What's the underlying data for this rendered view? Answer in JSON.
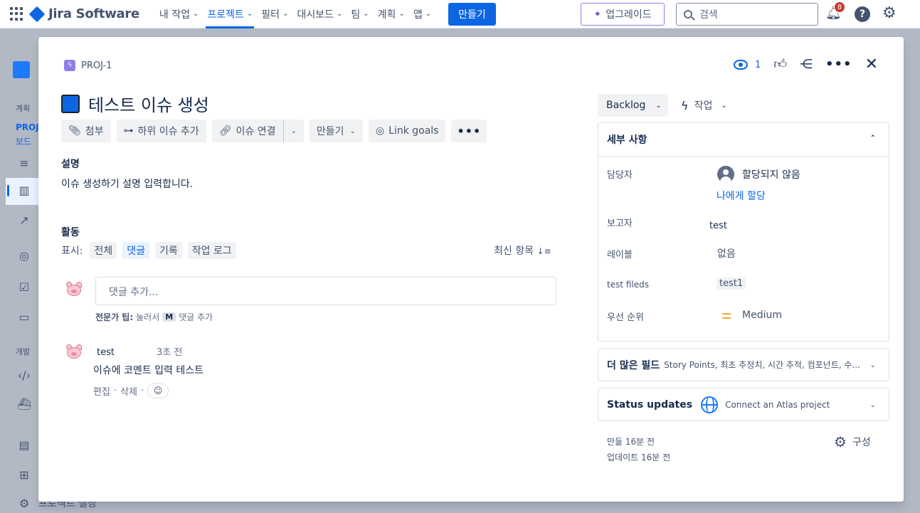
{
  "topnav": {
    "product": "Jira Software",
    "menu": [
      {
        "label": "내 작업",
        "active": false
      },
      {
        "label": "프로젝트",
        "active": true
      },
      {
        "label": "필터",
        "active": false
      },
      {
        "label": "대시보드",
        "active": false
      },
      {
        "label": "팀",
        "active": false
      },
      {
        "label": "계획",
        "active": false
      },
      {
        "label": "앱",
        "active": false
      }
    ],
    "create_label": "만들기",
    "upgrade_label": "업그레이드",
    "search_placeholder": "검색",
    "notifications_count": "8",
    "help_glyph": "?"
  },
  "sidebar": {
    "section_plan": "계획",
    "project_short": "PROJ",
    "board_label": "보드",
    "section_dev": "개발",
    "footer_label": "프로젝트 설정"
  },
  "issue": {
    "key": "PROJ-1",
    "watchers": "1",
    "title": "테스트 이슈 생성",
    "toolbar": {
      "attach": "첨부",
      "add_child": "하위 이슈 추가",
      "link_issue": "이슈 연결",
      "create": "만들기",
      "link_goals": "Link goals"
    },
    "description_heading": "설명",
    "description_text": "이슈 생성하기 설명 입력합니다.",
    "activity_heading": "활동",
    "show_label": "표시:",
    "filters": [
      {
        "label": "전체",
        "active": false
      },
      {
        "label": "댓글",
        "active": true
      },
      {
        "label": "기록",
        "active": false
      },
      {
        "label": "작업 로그",
        "active": false
      }
    ],
    "sort_label": "최신 항목",
    "comment_placeholder": "댓글 추가...",
    "tip_bold": "전문가 팁:",
    "tip_press": "눌러서",
    "tip_key": "M",
    "tip_rest": "댓글 추가",
    "comment": {
      "author": "test",
      "time": "3초 전",
      "body": "이슈에 코멘트 입력 테스트",
      "edit": "편집",
      "delete": "삭제"
    }
  },
  "right": {
    "status": "Backlog",
    "action": "작업",
    "details_heading": "세부 사항",
    "assignee_label": "담당자",
    "assignee_value": "할당되지 않음",
    "assign_to_me": "나에게 할당",
    "reporter_label": "보고자",
    "reporter_value": "test",
    "labels_label": "레이블",
    "labels_value": "없음",
    "custom_field_label": "test fileds",
    "custom_field_value": "test1",
    "priority_label": "우선 순위",
    "priority_value": "Medium",
    "more_fields_title": "더 많은 필드",
    "more_fields_sub": "Story Points, 최초 추정치, 시간 추적, 컴포넌트, 수...",
    "status_updates_title": "Status updates",
    "status_updates_sub": "Connect an Atlas project",
    "created": "만듦 16분 전",
    "updated": "업데이트 16분 전",
    "configure": "구성"
  },
  "colors": {
    "accent": "#0c66e4",
    "epic": "#8f7ee7",
    "priority_medium": "#f5a623",
    "notification_badge": "#c9372c"
  }
}
